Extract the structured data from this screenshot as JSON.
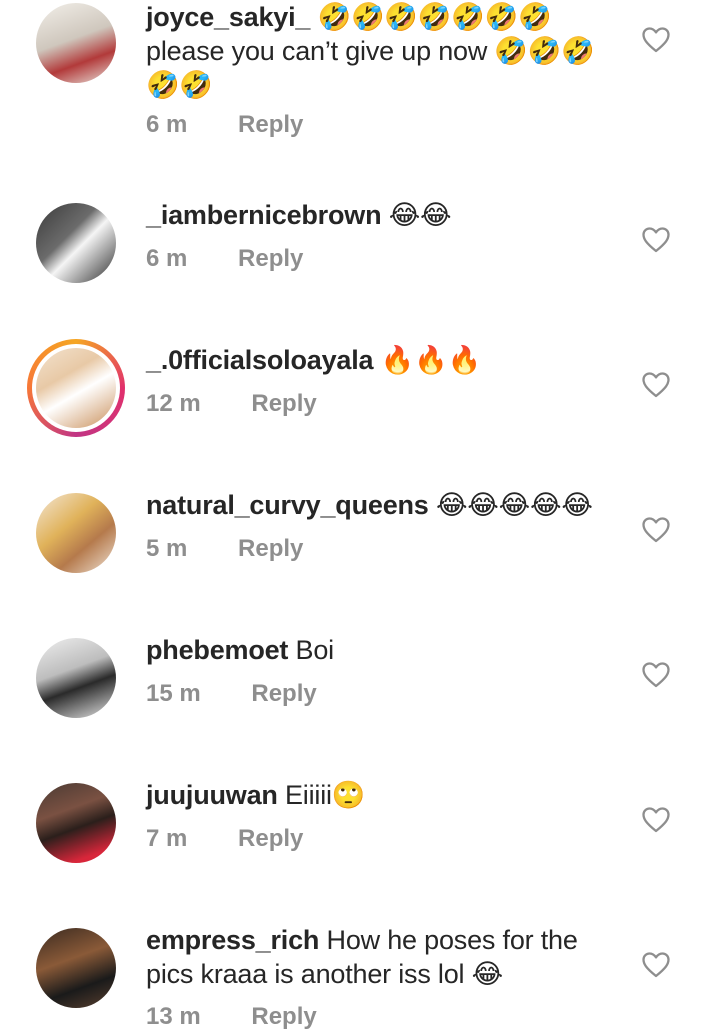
{
  "comments": [
    {
      "username": "joyce_sakyi_",
      "text": "🤣🤣🤣🤣🤣🤣🤣 please you can’t give up now 🤣🤣🤣🤣🤣",
      "time": "6 m",
      "reply": "Reply",
      "story_ring": false
    },
    {
      "username": "_iambernicebrown",
      "text": "😂😂",
      "time": "6 m",
      "reply": "Reply",
      "story_ring": false
    },
    {
      "username": "_.0fficialsoloayala",
      "text": "🔥🔥🔥",
      "time": "12 m",
      "reply": "Reply",
      "story_ring": true
    },
    {
      "username": "natural_curvy_queens",
      "text": "😂😂😂😂😂",
      "time": "5 m",
      "reply": "Reply",
      "story_ring": false
    },
    {
      "username": "phebemoet",
      "text": "Boi",
      "time": "15 m",
      "reply": "Reply",
      "story_ring": false
    },
    {
      "username": "juujuuwan",
      "text": "Eiiiii🙄",
      "time": "7 m",
      "reply": "Reply",
      "story_ring": false
    },
    {
      "username": "empress_rich",
      "text": "How he poses for the pics kraaa is another iss lol 😂",
      "time": "13 m",
      "reply": "Reply",
      "story_ring": false
    }
  ],
  "icons": {
    "like": "heart-outline-icon"
  },
  "colors": {
    "text": "#262626",
    "meta": "#8e8e8e",
    "icon": "#8e8e8e"
  }
}
